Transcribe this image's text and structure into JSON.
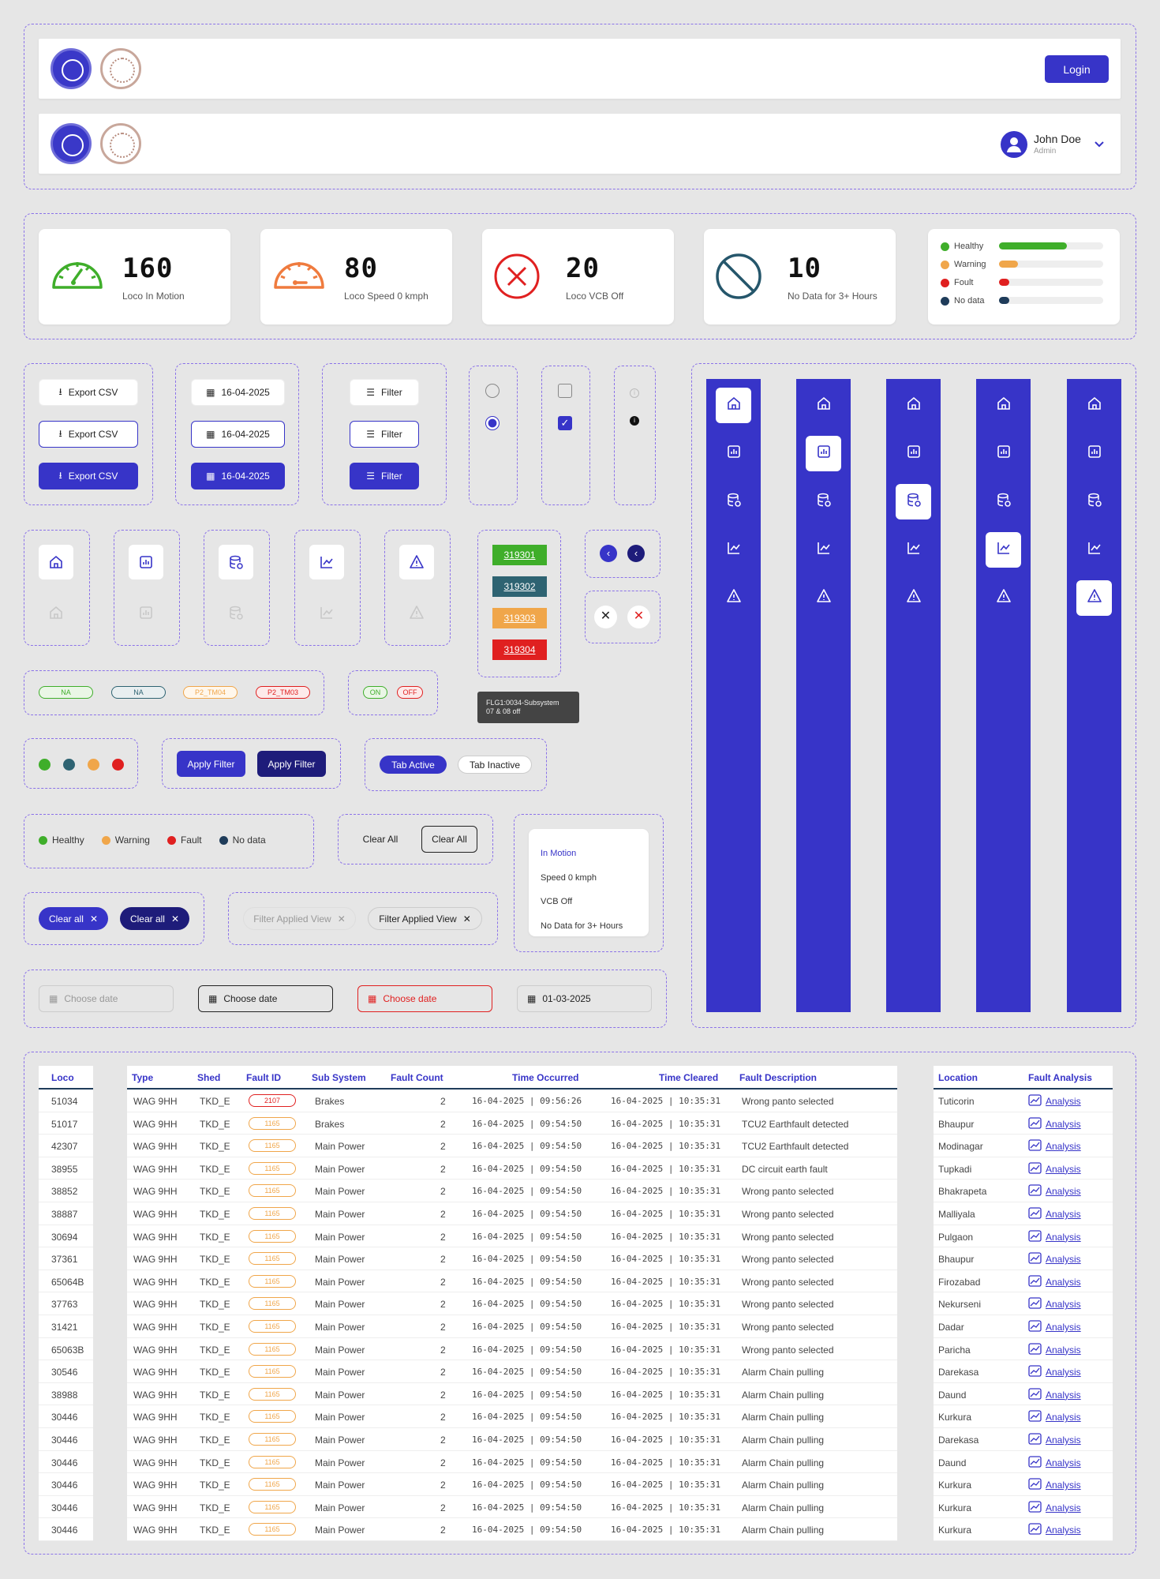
{
  "header": {
    "login_label": "Login",
    "user_name": "John Doe",
    "user_role": "Admin"
  },
  "stats": [
    {
      "value": "160",
      "label": "Loco In Motion",
      "color": "#3fae2a"
    },
    {
      "value": "80",
      "label": "Loco Speed 0 kmph",
      "color": "#ef7b3e"
    },
    {
      "value": "20",
      "label": "Loco VCB Off",
      "color": "#e02020"
    },
    {
      "value": "10",
      "label": "No Data for 3+ Hours",
      "color": "#25566b"
    }
  ],
  "legend_bars": [
    {
      "label": "Healthy",
      "color": "#3fae2a",
      "level": 0.65
    },
    {
      "label": "Warning",
      "color": "#f0a64a",
      "level": 0.18
    },
    {
      "label": "Foult",
      "color": "#e02020",
      "level": 0.1
    },
    {
      "label": "No data",
      "color": "#1f3c5a",
      "level": 0.1
    }
  ],
  "buttons": {
    "export": "Export CSV",
    "date": "16-04-2025",
    "filter": "Filter",
    "apply": "Apply Filter",
    "tab_active": "Tab Active",
    "tab_inactive": "Tab Inactive",
    "clear_all": "Clear All",
    "clear_all_small": "Clear all",
    "filter_view": "Filter Applied View"
  },
  "badges": {
    "na": "NA",
    "tm04": "P2_TM04",
    "tm03": "P2_TM03",
    "on": "ON",
    "off": "OFF"
  },
  "tags": [
    {
      "label": "319301",
      "color": "#3fae2a"
    },
    {
      "label": "319302",
      "color": "#2e6372"
    },
    {
      "label": "319303",
      "color": "#f0a64a"
    },
    {
      "label": "319304",
      "color": "#e02020"
    }
  ],
  "tooltip": {
    "line1": "FLG1:0034-Subsystem",
    "line2": "07 & 08 off"
  },
  "status_legend": [
    {
      "label": "Healthy",
      "color": "#3fae2a"
    },
    {
      "label": "Warning",
      "color": "#f0a64a"
    },
    {
      "label": "Fault",
      "color": "#e02020"
    },
    {
      "label": "No data",
      "color": "#1f3c5a"
    }
  ],
  "dot_colors": [
    "#3fae2a",
    "#2e6372",
    "#f0a64a",
    "#e02020"
  ],
  "dropdown": [
    "In Motion",
    "Speed 0 kmph",
    "VCB Off",
    "No Data for 3+ Hours"
  ],
  "dates": {
    "placeholder": "Choose date",
    "value": "01-03-2025"
  },
  "table": {
    "headers": [
      "Loco",
      "Type",
      "Shed",
      "Fault ID",
      "Sub System",
      "Fault Count",
      "Time Occurred",
      "Time Cleared",
      "Fault Description",
      "Location",
      "Fault Analysis"
    ],
    "link": "Analysis",
    "rows": [
      [
        "51034",
        "WAG 9HH",
        "TKD_E",
        "2107",
        "Brakes",
        "2",
        "16-04-2025 | 09:56:26",
        "16-04-2025 | 10:35:31",
        "Wrong panto selected",
        "Tuticorin"
      ],
      [
        "51017",
        "WAG 9HH",
        "TKD_E",
        "1165",
        "Brakes",
        "2",
        "16-04-2025 | 09:54:50",
        "16-04-2025 | 10:35:31",
        "TCU2 Earthfault detected",
        "Bhaupur"
      ],
      [
        "42307",
        "WAG 9HH",
        "TKD_E",
        "1165",
        "Main Power",
        "2",
        "16-04-2025 | 09:54:50",
        "16-04-2025 | 10:35:31",
        "TCU2 Earthfault detected",
        "Modinagar"
      ],
      [
        "38955",
        "WAG 9HH",
        "TKD_E",
        "1165",
        "Main Power",
        "2",
        "16-04-2025 | 09:54:50",
        "16-04-2025 | 10:35:31",
        "DC circuit earth fault",
        "Tupkadi"
      ],
      [
        "38852",
        "WAG 9HH",
        "TKD_E",
        "1165",
        "Main Power",
        "2",
        "16-04-2025 | 09:54:50",
        "16-04-2025 | 10:35:31",
        "Wrong panto selected",
        "Bhakrapeta"
      ],
      [
        "38887",
        "WAG 9HH",
        "TKD_E",
        "1165",
        "Main Power",
        "2",
        "16-04-2025 | 09:54:50",
        "16-04-2025 | 10:35:31",
        "Wrong panto selected",
        "Malliyala"
      ],
      [
        "30694",
        "WAG 9HH",
        "TKD_E",
        "1165",
        "Main Power",
        "2",
        "16-04-2025 | 09:54:50",
        "16-04-2025 | 10:35:31",
        "Wrong panto selected",
        "Pulgaon"
      ],
      [
        "37361",
        "WAG 9HH",
        "TKD_E",
        "1165",
        "Main Power",
        "2",
        "16-04-2025 | 09:54:50",
        "16-04-2025 | 10:35:31",
        "Wrong panto selected",
        "Bhaupur"
      ],
      [
        "65064B",
        "WAG 9HH",
        "TKD_E",
        "1165",
        "Main Power",
        "2",
        "16-04-2025 | 09:54:50",
        "16-04-2025 | 10:35:31",
        "Wrong panto selected",
        "Firozabad"
      ],
      [
        "37763",
        "WAG 9HH",
        "TKD_E",
        "1165",
        "Main Power",
        "2",
        "16-04-2025 | 09:54:50",
        "16-04-2025 | 10:35:31",
        "Wrong panto selected",
        "Nekurseni"
      ],
      [
        "31421",
        "WAG 9HH",
        "TKD_E",
        "1165",
        "Main Power",
        "2",
        "16-04-2025 | 09:54:50",
        "16-04-2025 | 10:35:31",
        "Wrong panto selected",
        "Dadar"
      ],
      [
        "65063B",
        "WAG 9HH",
        "TKD_E",
        "1165",
        "Main Power",
        "2",
        "16-04-2025 | 09:54:50",
        "16-04-2025 | 10:35:31",
        "Wrong panto selected",
        "Paricha"
      ],
      [
        "30546",
        "WAG 9HH",
        "TKD_E",
        "1165",
        "Main Power",
        "2",
        "16-04-2025 | 09:54:50",
        "16-04-2025 | 10:35:31",
        "Alarm Chain pulling",
        "Darekasa"
      ],
      [
        "38988",
        "WAG 9HH",
        "TKD_E",
        "1165",
        "Main Power",
        "2",
        "16-04-2025 | 09:54:50",
        "16-04-2025 | 10:35:31",
        "Alarm Chain pulling",
        "Daund"
      ],
      [
        "30446",
        "WAG 9HH",
        "TKD_E",
        "1165",
        "Main Power",
        "2",
        "16-04-2025 | 09:54:50",
        "16-04-2025 | 10:35:31",
        "Alarm Chain pulling",
        "Kurkura"
      ],
      [
        "30446",
        "WAG 9HH",
        "TKD_E",
        "1165",
        "Main Power",
        "2",
        "16-04-2025 | 09:54:50",
        "16-04-2025 | 10:35:31",
        "Alarm Chain pulling",
        "Darekasa"
      ],
      [
        "30446",
        "WAG 9HH",
        "TKD_E",
        "1165",
        "Main Power",
        "2",
        "16-04-2025 | 09:54:50",
        "16-04-2025 | 10:35:31",
        "Alarm Chain pulling",
        "Daund"
      ],
      [
        "30446",
        "WAG 9HH",
        "TKD_E",
        "1165",
        "Main Power",
        "2",
        "16-04-2025 | 09:54:50",
        "16-04-2025 | 10:35:31",
        "Alarm Chain pulling",
        "Kurkura"
      ],
      [
        "30446",
        "WAG 9HH",
        "TKD_E",
        "1165",
        "Main Power",
        "2",
        "16-04-2025 | 09:54:50",
        "16-04-2025 | 10:35:31",
        "Alarm Chain pulling",
        "Kurkura"
      ],
      [
        "30446",
        "WAG 9HH",
        "TKD_E",
        "1165",
        "Main Power",
        "2",
        "16-04-2025 | 09:54:50",
        "16-04-2025 | 10:35:31",
        "Alarm Chain pulling",
        "Kurkura"
      ]
    ]
  },
  "nav_icons": [
    "home-icon",
    "report-icon",
    "database-icon",
    "trend-icon",
    "warning-icon"
  ]
}
